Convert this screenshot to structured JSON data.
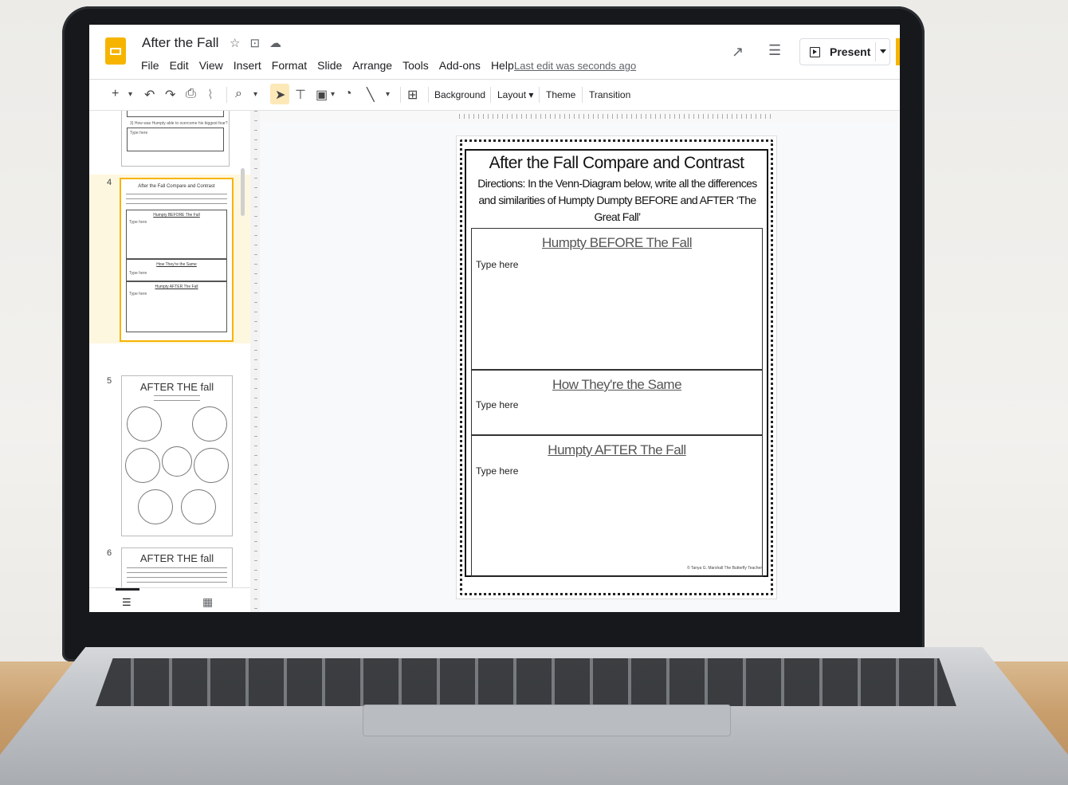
{
  "app": {
    "title": "After the Fall",
    "menu": [
      "File",
      "Edit",
      "View",
      "Insert",
      "Format",
      "Slide",
      "Arrange",
      "Tools",
      "Add-ons",
      "Help"
    ],
    "last_edit": "Last edit was seconds ago",
    "present_label": "Present"
  },
  "toolbar": {
    "background_label": "Background",
    "layout_label": "Layout ▾",
    "theme_label": "Theme",
    "transition_label": "Transition"
  },
  "filmstrip": {
    "slides": [
      {
        "num": "4",
        "title": "After the Fall Compare and Contrast",
        "subs": [
          "Humpty BEFORE The Fall",
          "How They're the Same",
          "Humpty AFTER The Fall"
        ]
      },
      {
        "num": "5",
        "title": "AFTER THE fall"
      },
      {
        "num": "6",
        "title": "AFTER THE fall"
      }
    ],
    "partial_prompt": "3) How was Humpty able to overcome his biggest fear?",
    "type_here_small": "Type here"
  },
  "slide": {
    "title": "After the Fall Compare and Contrast",
    "directions": "Directions: In the Venn-Diagram below, write all the differences and similarities of Humpty Dumpty BEFORE and AFTER ‘The Great Fall’",
    "sections": [
      {
        "heading": "Humpty BEFORE The Fall",
        "placeholder": "Type here"
      },
      {
        "heading": "How They're the Same",
        "placeholder": "Type here"
      },
      {
        "heading": "Humpty AFTER The Fall",
        "placeholder": "Type here"
      }
    ],
    "copyright": "© Tanya G. Marshall The Butterfly Teacher"
  },
  "icons": {
    "star": "star-icon",
    "folder": "move-to-folder-icon",
    "cloud": "cloud-status-icon"
  }
}
